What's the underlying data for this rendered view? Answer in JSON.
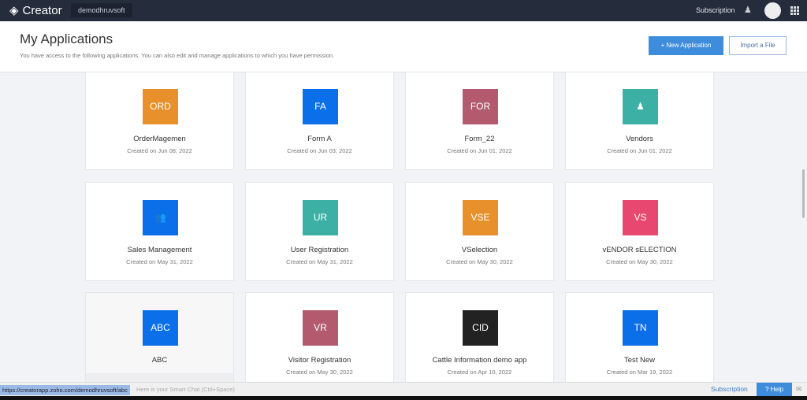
{
  "topbar": {
    "brand": "Creator",
    "org": "demodhruvsoft",
    "subscription": "Subscription"
  },
  "header": {
    "title": "My Applications",
    "description": "You have access to the following applications. You can also edit and manage applications to which you have permission.",
    "new_button": "+ New Application",
    "import_button": "Import a File"
  },
  "apps": [
    {
      "abbr": "ORD",
      "name": "OrderMagemen",
      "date": "Created on Jun 08, 2022",
      "color": "#e8912c"
    },
    {
      "abbr": "FA",
      "name": "Form A",
      "date": "Created on Jun 03, 2022",
      "color": "#0a6fe8"
    },
    {
      "abbr": "FOR",
      "name": "Form_22",
      "date": "Created on Jun 01, 2022",
      "color": "#b35a6f"
    },
    {
      "abbr": "",
      "icon": "person-icon",
      "name": "Vendors",
      "date": "Created on Jun 01, 2022",
      "color": "#3cb0a4"
    },
    {
      "abbr": "",
      "icon": "group-icon",
      "name": "Sales Management",
      "date": "Created on May 31, 2022",
      "color": "#0a6fe8"
    },
    {
      "abbr": "UR",
      "name": "User Registration",
      "date": "Created on May 31, 2022",
      "color": "#3cb0a4"
    },
    {
      "abbr": "VSE",
      "name": "VSelection",
      "date": "Created on May 30, 2022",
      "color": "#e8912c"
    },
    {
      "abbr": "VS",
      "name": "vENDOR sELECTION",
      "date": "Created on May 30, 2022",
      "color": "#e8476f"
    },
    {
      "abbr": "ABC",
      "name": "ABC",
      "date": "",
      "color": "#0a6fe8"
    },
    {
      "abbr": "VR",
      "name": "Visitor Registration",
      "date": "Created on May 30, 2022",
      "color": "#b35a6f"
    },
    {
      "abbr": "CID",
      "name": "Cattle Information demo app",
      "date": "Created on Apr 10, 2022",
      "color": "#222222"
    },
    {
      "abbr": "TN",
      "name": "Test New",
      "date": "Created on Mar 19, 2022",
      "color": "#0a6fe8"
    }
  ],
  "statusbar": {
    "url": "https://creatorapp.zoho.com/demodhruvsoft/abc",
    "smart_chat": "Here is your Smart Chat (Ctrl+Space)",
    "subscription": "Subscription",
    "help": "? Help"
  }
}
